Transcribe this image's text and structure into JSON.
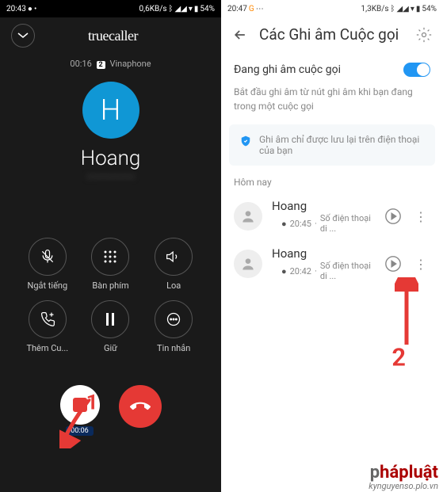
{
  "left": {
    "status": {
      "time": "20:43",
      "data": "0,6KB/s",
      "battery": "54%"
    },
    "app_name": "truecaller",
    "call": {
      "duration": "00:16",
      "sim": "2",
      "carrier": "Vinaphone",
      "avatar_letter": "H",
      "name": "Hoang"
    },
    "controls": {
      "mute": "Ngắt tiếng",
      "keypad": "Bàn phím",
      "speaker": "Loa",
      "add": "Thêm Cu...",
      "hold": "Giữ",
      "message": "Tin nhắn"
    },
    "record_time": "00:06"
  },
  "right": {
    "status": {
      "time": "20:47",
      "data": "1,3KB/s",
      "battery": "54%"
    },
    "title": "Các Ghi âm Cuộc gọi",
    "toggle_label": "Đang ghi âm cuộc gọi",
    "toggle_desc": "Bắt đầu ghi âm từ nút ghi âm khi bạn đang trong một cuộc gọi",
    "info_text": "Ghi âm chỉ được lưu lại trên điện thoại của bạn",
    "section": "Hôm nay",
    "items": [
      {
        "name": "Hoang",
        "time": "20:45",
        "detail": "Số điện thoại di ..."
      },
      {
        "name": "Hoang",
        "time": "20:42",
        "detail": "Số điện thoại di ..."
      }
    ]
  },
  "annotations": {
    "one": "1",
    "two": "2"
  },
  "watermark": {
    "brand_p": "p",
    "brand_rest": "hápluật",
    "site": "kynguyenso.plo.vn"
  }
}
